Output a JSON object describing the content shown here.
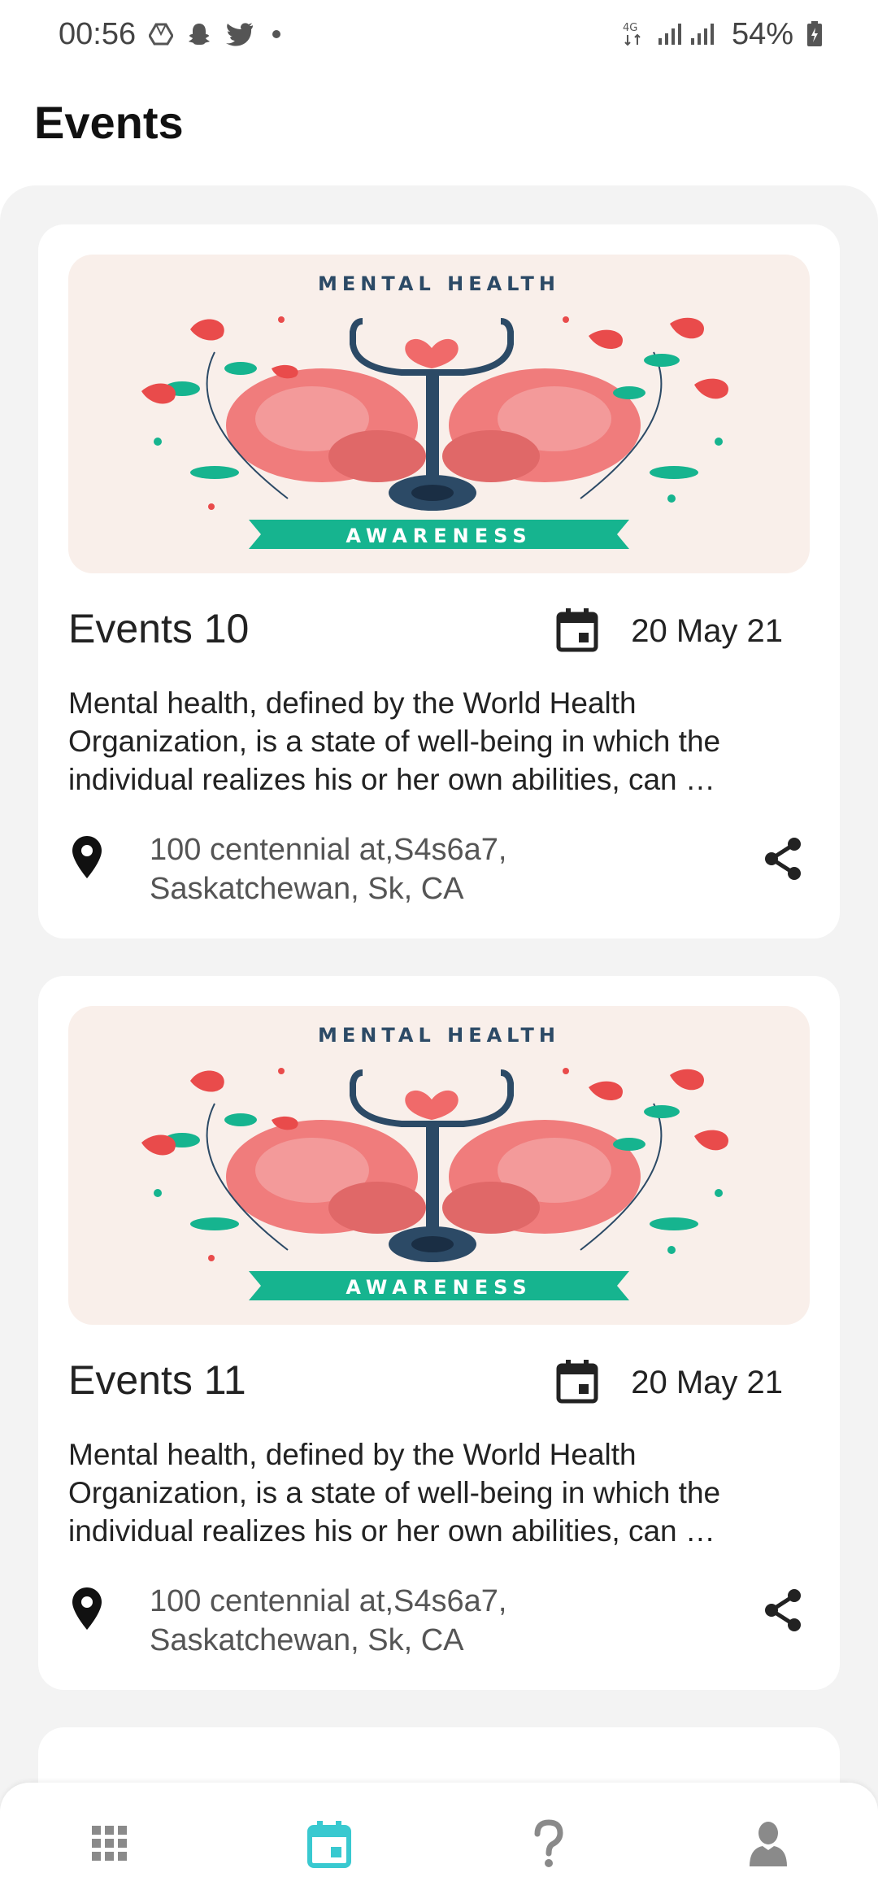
{
  "status_bar": {
    "time": "00:56",
    "battery": "54%",
    "network": "4G",
    "icons": [
      "drive-icon",
      "snapchat-icon",
      "twitter-icon",
      "notification-dot",
      "signal-icon",
      "battery-icon"
    ]
  },
  "header": {
    "title": "Events"
  },
  "events": [
    {
      "title": "Events 10",
      "date": "20 May 21",
      "description": "Mental health, defined by the World Health Organization, is a state of well-being in which the individual realizes his or her own abilities, can …",
      "address": "100 centennial at,S4s6a7, Saskatchewan, Sk, CA",
      "banner": {
        "top_text": "MENTAL HEALTH",
        "bottom_text": "AWARENESS"
      }
    },
    {
      "title": "Events 11",
      "date": "20 May 21",
      "description": "Mental health, defined by the World Health Organization, is a state of well-being in which the individual realizes his or her own abilities, can …",
      "address": "100 centennial at,S4s6a7, Saskatchewan, Sk, CA",
      "banner": {
        "top_text": "MENTAL HEALTH",
        "bottom_text": "AWARENESS"
      }
    }
  ],
  "bottom_nav": {
    "items": [
      "grid-icon",
      "calendar-icon",
      "help-icon",
      "profile-icon"
    ],
    "active": "calendar-icon",
    "active_color": "#39c9d0",
    "inactive_color": "#8a8a8a"
  },
  "colors": {
    "banner_bg": "#f9efea",
    "awareness_ribbon": "#16b48f",
    "brain": "#f07878",
    "navy": "#2c4a66"
  }
}
